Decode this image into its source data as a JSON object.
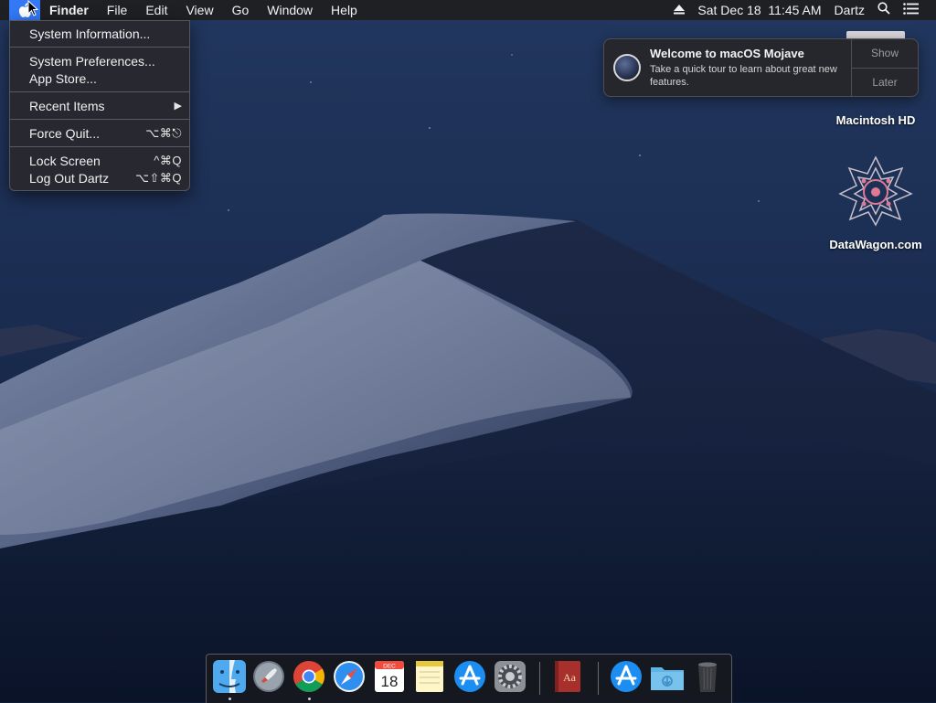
{
  "menubar": {
    "app_name": "Finder",
    "menus": [
      "File",
      "Edit",
      "View",
      "Go",
      "Window",
      "Help"
    ],
    "status": {
      "eject_icon": "eject-icon",
      "datetime": "Sat Dec 18  11:45 AM",
      "user": "Dartz",
      "search_icon": "search-icon",
      "control_icon": "list-icon"
    }
  },
  "apple_menu": {
    "items": [
      {
        "label": "System Information..."
      },
      {
        "label": "System Preferences..."
      },
      {
        "label": "App Store..."
      },
      {
        "label": "Recent Items",
        "submenu": true
      },
      {
        "label": "Force Quit...",
        "shortcut": "⌥⌘⎋"
      },
      {
        "label": "Lock Screen",
        "shortcut": "^⌘Q"
      },
      {
        "label": "Log Out Dartz",
        "shortcut": "⌥⇧⌘Q"
      }
    ]
  },
  "notification": {
    "title": "Welcome to macOS Mojave",
    "message": "Take a quick tour to learn about great new features.",
    "show_label": "Show",
    "later_label": "Later"
  },
  "desktop": {
    "icons": [
      {
        "label": "Macintosh HD",
        "icon": "hard-drive-icon"
      },
      {
        "label": "DataWagon.com",
        "icon": "datawagon-icon"
      }
    ]
  },
  "dock": {
    "apps": [
      {
        "icon": "finder-icon",
        "running": true
      },
      {
        "icon": "launchpad-icon",
        "running": false
      },
      {
        "icon": "chrome-icon",
        "running": true
      },
      {
        "icon": "safari-icon",
        "running": false
      },
      {
        "icon": "calendar-icon",
        "running": false,
        "month": "DEC",
        "day": "18"
      },
      {
        "icon": "notes-icon",
        "running": false
      },
      {
        "icon": "app-store-icon",
        "running": false
      },
      {
        "icon": "system-preferences-icon",
        "running": false
      },
      {
        "icon": "dictionary-icon",
        "running": false,
        "glyph": "Aa"
      },
      {
        "icon": "app-store-downloads-icon",
        "running": false
      },
      {
        "icon": "downloads-folder-icon",
        "running": false
      },
      {
        "icon": "trash-icon",
        "running": false
      }
    ]
  },
  "colors": {
    "menubar_bg": "#1f2024",
    "accent": "#3478f6",
    "wallpaper_sky": "#1d2f55"
  }
}
